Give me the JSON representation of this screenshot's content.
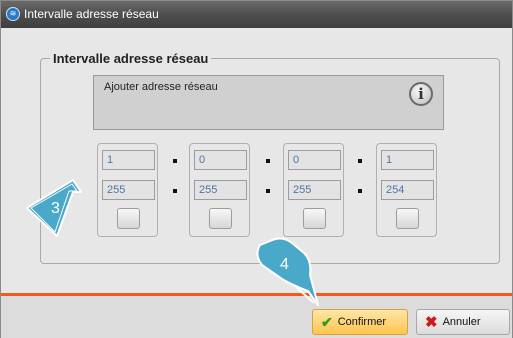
{
  "window": {
    "title": "Intervalle adresse réseau"
  },
  "group": {
    "legend": "Intervalle adresse réseau"
  },
  "info": {
    "text": "Ajouter adresse réseau",
    "icon": "info-icon"
  },
  "octets": [
    {
      "start": "1",
      "mask": "255"
    },
    {
      "start": "0",
      "mask": "255"
    },
    {
      "start": "0",
      "mask": "255"
    },
    {
      "start": "1",
      "mask": "254"
    }
  ],
  "buttons": {
    "confirm": "Confirmer",
    "cancel": "Annuler"
  },
  "callouts": {
    "step3": "3",
    "step4": "4"
  },
  "colors": {
    "accent_line": "#f05a22",
    "confirm_bg": "#ffc44d",
    "titlebar": "#4e4e4e",
    "field_text": "#4d74a6"
  }
}
